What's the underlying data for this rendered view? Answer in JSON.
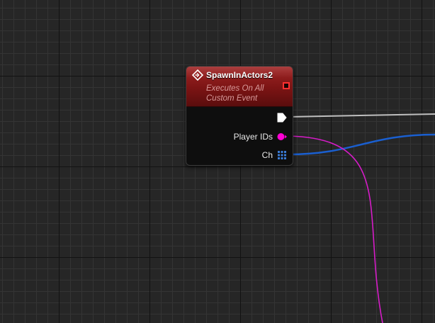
{
  "node": {
    "title": "SpawnInActors2",
    "subtitle_line1": "Executes On All",
    "subtitle_line2": "Custom Event",
    "header_color": "#8b1a1a",
    "pins": [
      {
        "name": "exec",
        "label": "",
        "type": "exec",
        "color": "#ffffff"
      },
      {
        "name": "player-ids",
        "label": "Player IDs",
        "type": "data",
        "color": "#ff00d4"
      },
      {
        "name": "ch",
        "label": "Ch",
        "type": "array",
        "color": "#3a7bd5"
      }
    ]
  },
  "wires": [
    {
      "name": "exec-wire",
      "color": "#c8c8c8"
    },
    {
      "name": "player-ids-wire",
      "color": "#d61cc8"
    },
    {
      "name": "ch-wire",
      "color": "#1a5fd0"
    }
  ]
}
